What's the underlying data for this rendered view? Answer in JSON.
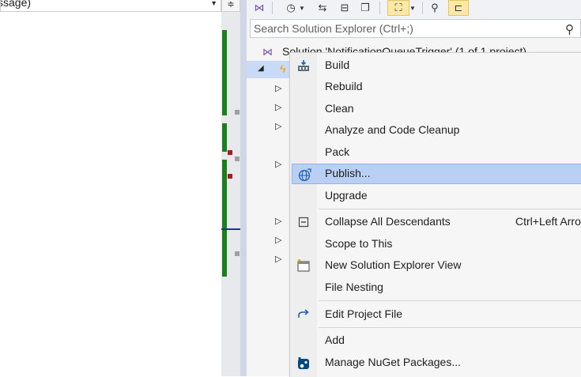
{
  "editor": {
    "dropdown_text": "ssage)"
  },
  "explorer": {
    "search_placeholder": "Search Solution Explorer (Ctrl+;)",
    "solution_label": "Solution 'NotificationQueueTrigger' (1 of 1 project)",
    "toolbar_icons": [
      "vs-icon",
      "history-icon",
      "sync-icon",
      "collapse-icon",
      "copy-icon",
      "tree-icon",
      "properties-icon",
      "preview-icon"
    ]
  },
  "menu": {
    "items": [
      {
        "label": "Build",
        "icon": "build-icon"
      },
      {
        "label": "Rebuild"
      },
      {
        "label": "Clean"
      },
      {
        "label": "Analyze and Code Cleanup"
      },
      {
        "label": "Pack"
      },
      {
        "label": "Publish...",
        "icon": "publish-globe-icon"
      },
      {
        "label": "Upgrade"
      },
      {
        "label": "Collapse All Descendants",
        "icon": "collapse-icon",
        "shortcut": "Ctrl+Left Arro"
      },
      {
        "label": "Scope to This"
      },
      {
        "label": "New Solution Explorer View",
        "icon": "new-view-icon"
      },
      {
        "label": "File Nesting"
      },
      {
        "label": "Edit Project File",
        "icon": "edit-arrow-icon"
      },
      {
        "label": "Add"
      },
      {
        "label": "Manage NuGet Packages...",
        "icon": "nuget-icon"
      }
    ]
  },
  "colors": {
    "highlight": "#b9d0f4",
    "selection": "#c8daf5",
    "accent_bar": "#1b7f1b"
  }
}
